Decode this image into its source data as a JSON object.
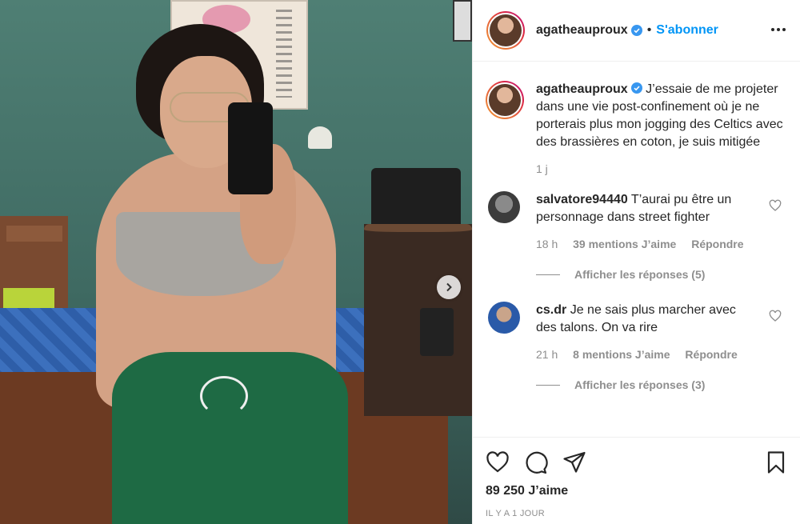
{
  "header": {
    "username": "agatheauproux",
    "separator": "•",
    "follow_label": "S'abonner"
  },
  "caption": {
    "username": "agatheauproux",
    "text": "J’essaie de me projeter dans une vie post-confinement où je ne porterais plus mon jogging des Celtics avec des brassières en coton, je suis mitigée",
    "time": "1 j"
  },
  "comments": [
    {
      "username": "salvatore94440",
      "text": "T’aurai pu être un personnage dans street fighter",
      "time": "18 h",
      "likes": "39 mentions J’aime",
      "reply": "Répondre",
      "show_replies": "Afficher les réponses (5)"
    },
    {
      "username": "cs.dr",
      "text": "Je ne sais plus marcher avec des talons. On va rire",
      "time": "21 h",
      "likes": "8 mentions J’aime",
      "reply": "Répondre",
      "show_replies": "Afficher les réponses (3)"
    }
  ],
  "footer": {
    "likes": "89 250 J’aime",
    "timestamp": "IL Y A 1 JOUR"
  },
  "icons": {
    "like": "heart-icon",
    "comment": "comment-icon",
    "share": "share-icon",
    "save": "bookmark-icon",
    "more": "more-options-icon",
    "next": "chevron-right-icon",
    "verified": "verified-badge-icon"
  },
  "colors": {
    "link": "#0095f6",
    "verified": "#3897f0",
    "muted": "#8e8e8e",
    "text": "#262626"
  }
}
